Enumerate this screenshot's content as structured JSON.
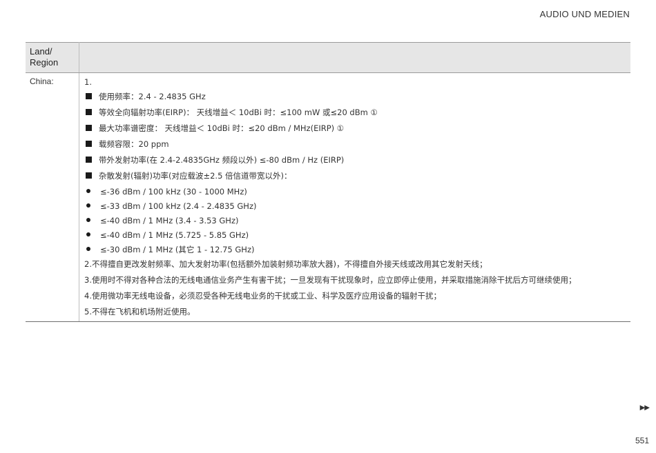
{
  "header": {
    "section_title": "AUDIO UND MEDIEN"
  },
  "table": {
    "col_land_label": "Land/\nRegion",
    "col_content_label": "",
    "rows": [
      {
        "land": "China:",
        "item1_number": "1.",
        "item1_points": [
          "使用频率：2.4 - 2.4835 GHz",
          "等效全向辐射功率(EIRP)： 天线增益＜ 10dBi 时：≤100 mW 或≤20 dBm ①",
          "最大功率谱密度： 天线增益＜ 10dBi 时：≤20 dBm / MHz(EIRP) ①",
          "载频容限：20 ppm",
          "带外发射功率(在 2.4-2.4835GHz 频段以外) ≤-80 dBm / Hz (EIRP)",
          "杂散发射(辐射)功率(对应载波±2.5 倍信道带宽以外)："
        ],
        "spurious_limits": [
          "≤-36 dBm / 100 kHz (30 - 1000 MHz)",
          "≤-33 dBm / 100 kHz (2.4 - 2.4835 GHz)",
          "≤-40 dBm / 1 MHz (3.4 - 3.53 GHz)",
          "≤-40 dBm / 1 MHz (5.725 - 5.85 GHz)",
          "≤-30 dBm / 1 MHz (其它 1 - 12.75 GHz)"
        ],
        "numbered_items": [
          "2.不得擅自更改发射频率、加大发射功率(包括额外加装射频功率放大器)，不得擅自外接天线或改用其它发射天线；",
          "3.使用时不得对各种合法的无线电通信业务产生有害干扰；一旦发现有干扰现象时，应立即停止使用，并采取措施消除干扰后方可继续使用；",
          "4.使用微功率无线电设备，必须忍受各种无线电业务的干扰或工业、科学及医疗应用设备的辐射干扰；",
          "5.不得在飞机和机场附近使用。"
        ]
      }
    ]
  },
  "footer": {
    "nav_icon": "double-arrow-right-icon",
    "nav_glyph": "▶▶",
    "page_number": "551"
  }
}
